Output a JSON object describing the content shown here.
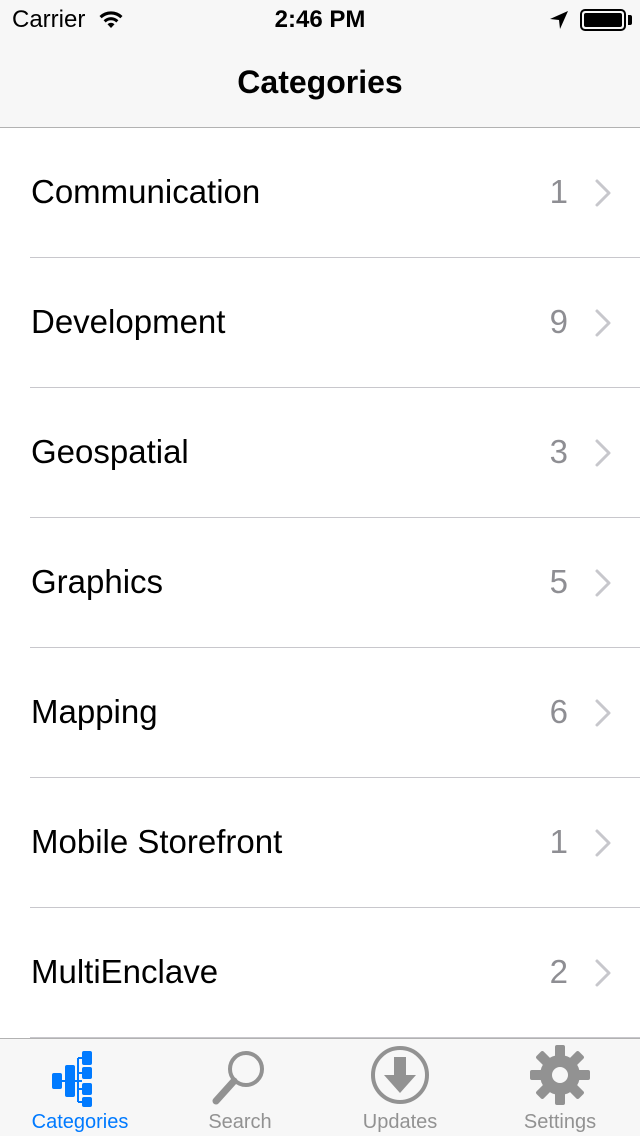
{
  "status_bar": {
    "carrier": "Carrier",
    "time": "2:46 PM"
  },
  "nav": {
    "title": "Categories"
  },
  "categories": [
    {
      "label": "Communication",
      "count": "1"
    },
    {
      "label": "Development",
      "count": "9"
    },
    {
      "label": "Geospatial",
      "count": "3"
    },
    {
      "label": "Graphics",
      "count": "5"
    },
    {
      "label": "Mapping",
      "count": "6"
    },
    {
      "label": "Mobile Storefront",
      "count": "1"
    },
    {
      "label": "MultiEnclave",
      "count": "2"
    }
  ],
  "tabs": [
    {
      "label": "Categories",
      "icon": "tree-icon",
      "active": true
    },
    {
      "label": "Search",
      "icon": "magnifier-icon",
      "active": false
    },
    {
      "label": "Updates",
      "icon": "download-circle-icon",
      "active": false
    },
    {
      "label": "Settings",
      "icon": "gear-icon",
      "active": false
    }
  ],
  "colors": {
    "accent": "#007aff",
    "inactive_tab": "#929292",
    "count_text": "#8e8e93",
    "chevron": "#c7c7cc",
    "bar_background": "#f7f7f7"
  }
}
